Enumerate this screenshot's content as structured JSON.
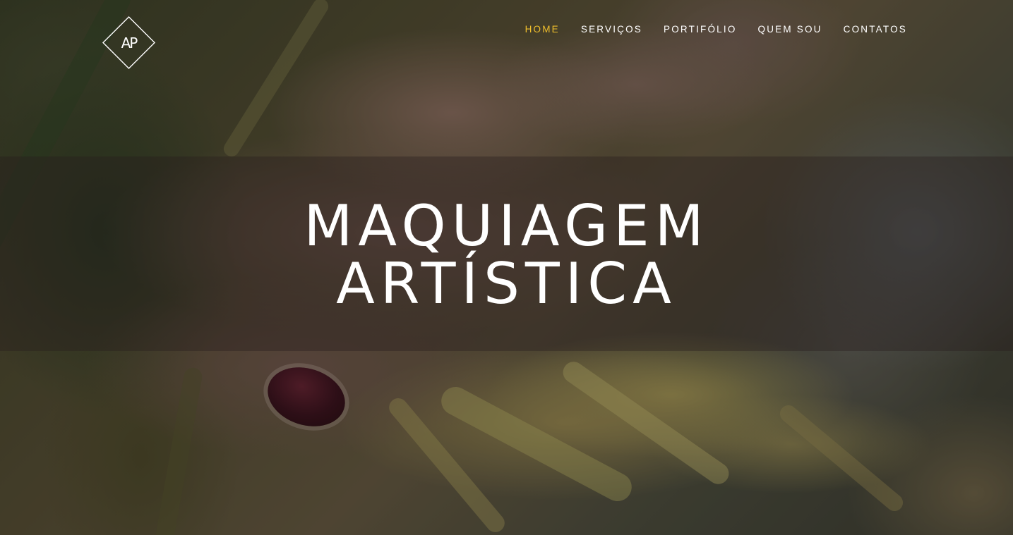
{
  "logo": {
    "text": "AP",
    "icon": "diamond-logo-icon"
  },
  "nav": {
    "items": [
      {
        "label": "HOME",
        "active": true
      },
      {
        "label": "SERVIÇOS",
        "active": false
      },
      {
        "label": "PORTIFÓLIO",
        "active": false
      },
      {
        "label": "QUEM SOU",
        "active": false
      },
      {
        "label": "CONTATOS",
        "active": false
      }
    ]
  },
  "hero": {
    "line1": "MAQUIAGEM",
    "line2": "ARTÍSTICA"
  },
  "colors": {
    "accent": "#f0bf2c",
    "text": "#ffffff"
  }
}
